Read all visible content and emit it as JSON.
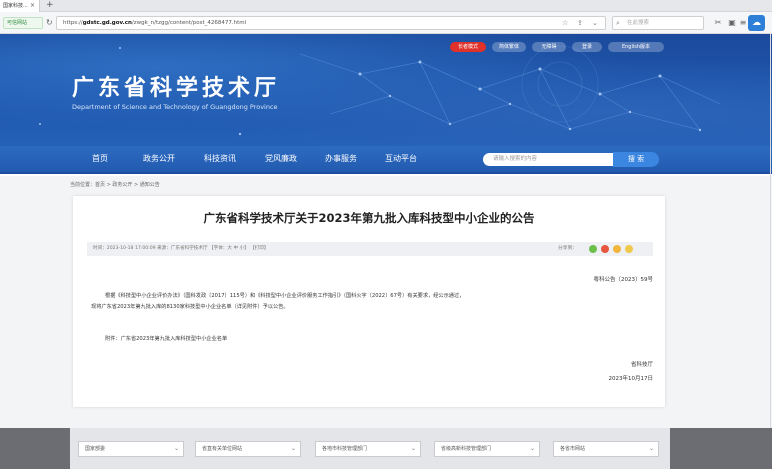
{
  "browser": {
    "tab_title": "国家科技...",
    "url_prefix": "https://",
    "url_host": "gdstc.gd.gov.cn",
    "url_path": "/zwgk_n/tzgg/content/post_4268477.html",
    "search_placeholder": "在此搜索",
    "site_badge": "可信网站"
  },
  "header": {
    "title": "广东省科学技术厅",
    "subtitle": "Department of Science and Technology of Guangdong Province",
    "utility_links": [
      "长者模式",
      "简体繁体",
      "无障碍",
      "登录",
      "English版本"
    ]
  },
  "nav": {
    "items": [
      "首页",
      "政务公开",
      "科技资讯",
      "党风廉政",
      "办事服务",
      "互动平台"
    ],
    "search_placeholder": "请输入搜索的内容",
    "search_button": "搜 索"
  },
  "breadcrumb": "当前位置：首页 > 政务公开 > 通知公告",
  "article": {
    "title": "广东省科学技术厅关于2023年第九批入库科技型中小企业的公告",
    "meta": "时间：2023-10-18 17:00:09    来源：广东省科学技术厅    【字体：大  中  小】    【打印】",
    "share_label": "分享到：",
    "doc_number": "粤科公告〔2023〕59号",
    "paragraph_1": "根据《科技型中小企业评价办法》（国科发政〔2017〕115号）和《科技型中小企业评价服务工作指引》（国科火字〔2022〕67号）有关要求，经公示通过，",
    "paragraph_2": "现将广东省2023年第九批入库的8130家科技型中小企业名单（详见附件）予以公告。",
    "attachment": "附件：广东省2023年第九批入库科技型中小企业名单",
    "signature": "省科技厅",
    "date": "2023年10月17日"
  },
  "footer": {
    "link_groups": [
      "国家部委",
      "省直有关单位网站",
      "各地市科技管理部门",
      "省级高新科技管理部门",
      "各省市网站"
    ]
  },
  "colors": {
    "header_blue": "#1e56ac",
    "nav_blue": "#2461b8",
    "utility_red": "#e0312a",
    "search_button_blue": "#3a86e0"
  }
}
